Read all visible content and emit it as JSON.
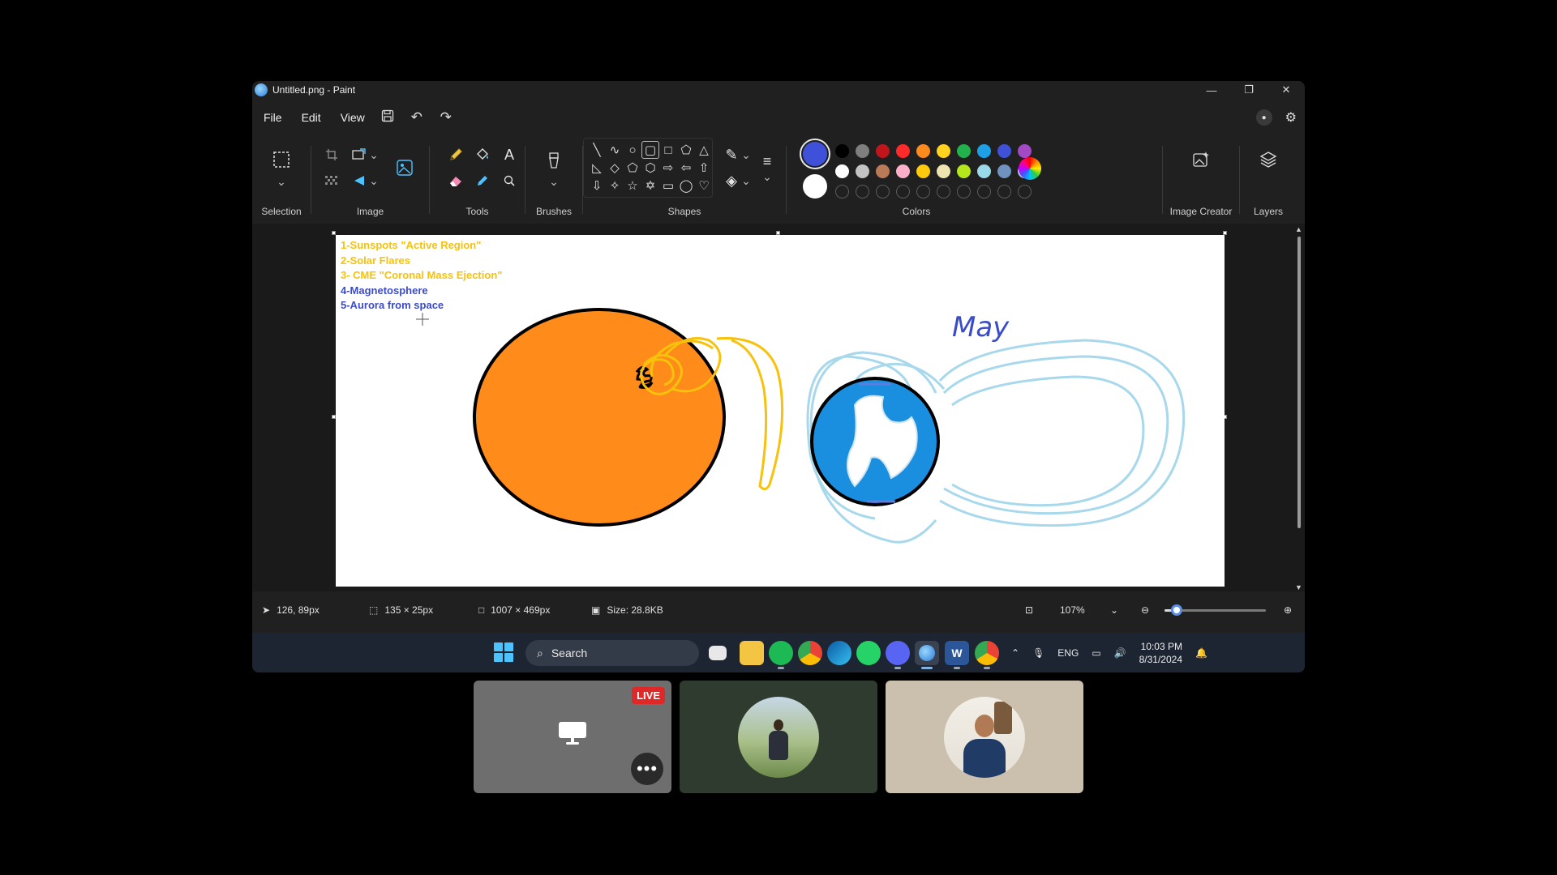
{
  "window": {
    "title": "Untitled.png - Paint",
    "minimize_glyph": "—",
    "restore_glyph": "❐",
    "close_glyph": "✕"
  },
  "menu": {
    "file": "File",
    "edit": "Edit",
    "view": "View",
    "save_icon": "save-icon",
    "undo_icon": "undo-icon",
    "redo_icon": "redo-icon"
  },
  "ribbon": {
    "groups": {
      "selection": "Selection",
      "image": "Image",
      "tools": "Tools",
      "brushes": "Brushes",
      "shapes": "Shapes",
      "colors": "Colors",
      "image_creator": "Image Creator",
      "layers": "Layers"
    }
  },
  "colors": {
    "active_primary": "#3f51d8",
    "secondary": "#ffffff",
    "palette_row1": [
      "#000000",
      "#7f7f7f",
      "#c0151a",
      "#ff2a2a",
      "#ff8a1e",
      "#ffd21f",
      "#22b14c",
      "#1ea0e6",
      "#3f51d8",
      "#a349c4"
    ],
    "palette_row2": [
      "#ffffff",
      "#c3c3c3",
      "#b97a57",
      "#ffaec9",
      "#ffc90e",
      "#efe4b0",
      "#b5e61d",
      "#99d9ea",
      "#7092be",
      "#c8bfe7"
    ]
  },
  "canvas": {
    "list_items": [
      {
        "text": "1-Sunspots \"Active Region\"",
        "color": "#f7c10c"
      },
      {
        "text": "2-Solar Flares",
        "color": "#f7c10c"
      },
      {
        "text": "3- CME \"Coronal Mass Ejection\"",
        "color": "#f7c10c"
      },
      {
        "text": "4-Magnetosphere",
        "color": "#3b4cca"
      },
      {
        "text": "5-Aurora from space",
        "color": "#3b4cca"
      }
    ],
    "handwritten": "May",
    "sun_color": "#ff8c1a",
    "earth_color": "#1a8fe0",
    "field_color": "#a8d8ec"
  },
  "status": {
    "cursor_pos": "126, 89px",
    "selection_size": "135 × 25px",
    "canvas_size": "1007 × 469px",
    "file_size": "Size: 28.8KB",
    "zoom": "107%",
    "zoom_level_fraction": 0.12
  },
  "taskbar": {
    "search_placeholder": "Search",
    "lang": "ENG",
    "time": "10:03 PM",
    "date": "8/31/2024",
    "apps": [
      "task-view",
      "file-explorer",
      "spotify",
      "chrome",
      "edge",
      "whatsapp",
      "discord",
      "paint",
      "word",
      "chrome-profile"
    ]
  },
  "meeting": {
    "live_label": "LIVE",
    "more_glyph": "•••"
  }
}
